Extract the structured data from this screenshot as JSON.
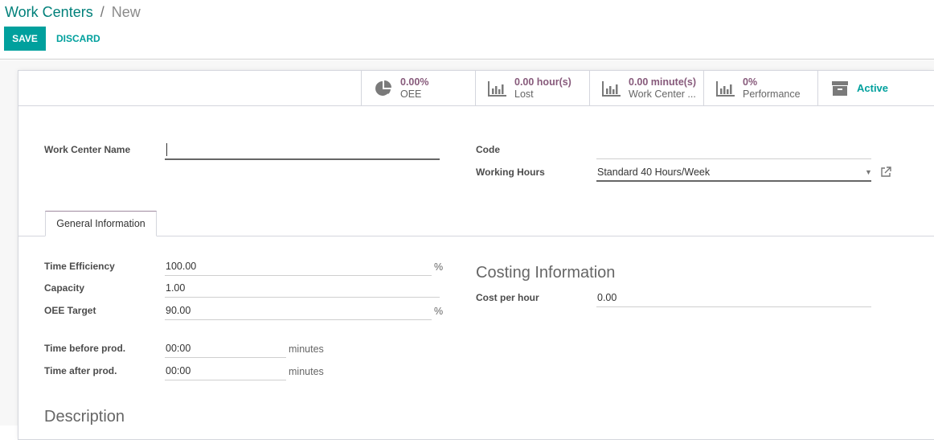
{
  "breadcrumb": {
    "parent": "Work Centers",
    "separator": "/",
    "current": "New"
  },
  "toolbar": {
    "save_label": "SAVE",
    "discard_label": "DISCARD"
  },
  "stat_buttons": [
    {
      "icon": "pie-chart-icon",
      "value": "0.00%",
      "label": "OEE"
    },
    {
      "icon": "bar-chart-icon",
      "value": "0.00 hour(s)",
      "label": "Lost"
    },
    {
      "icon": "bar-chart-icon",
      "value": "0.00 minute(s)",
      "label": "Work Center ..."
    },
    {
      "icon": "bar-chart-icon",
      "value": "0%",
      "label": "Performance"
    },
    {
      "icon": "archive-icon",
      "label": "Active"
    }
  ],
  "header_fields": {
    "name": {
      "label": "Work Center Name",
      "value": ""
    },
    "code": {
      "label": "Code",
      "value": ""
    },
    "working_hours": {
      "label": "Working Hours",
      "value": "Standard 40 Hours/Week"
    }
  },
  "tabs": [
    {
      "label": "General Information",
      "active": true
    }
  ],
  "general": {
    "time_efficiency": {
      "label": "Time Efficiency",
      "value": "100.00",
      "unit": "%"
    },
    "capacity": {
      "label": "Capacity",
      "value": "1.00"
    },
    "oee_target": {
      "label": "OEE Target",
      "value": "90.00",
      "unit": "%"
    },
    "time_before": {
      "label": "Time before prod.",
      "value": "00:00",
      "unit": "minutes"
    },
    "time_after": {
      "label": "Time after prod.",
      "value": "00:00",
      "unit": "minutes"
    }
  },
  "costing": {
    "title": "Costing Information",
    "cost_per_hour": {
      "label": "Cost per hour",
      "value": "0.00"
    }
  },
  "description": {
    "title": "Description"
  },
  "colors": {
    "primary": "#00a09d",
    "stat_value": "#875a7b",
    "link": "#00807a"
  }
}
